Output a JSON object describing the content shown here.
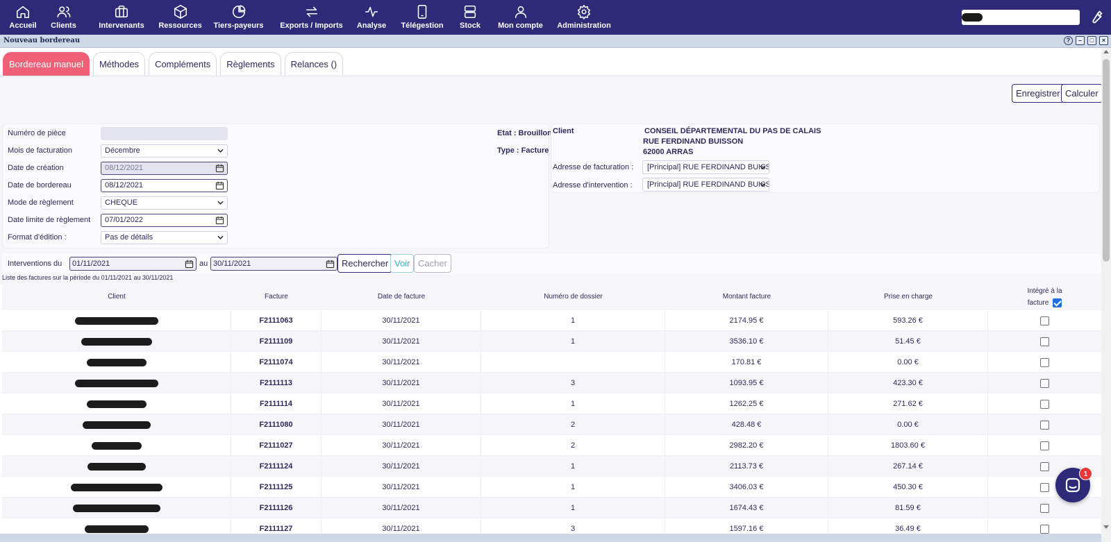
{
  "nav": {
    "items": [
      {
        "label": "Accueil",
        "icon": "home-icon"
      },
      {
        "label": "Clients",
        "icon": "users-icon"
      },
      {
        "label": "Intervenants",
        "icon": "briefcase-icon"
      },
      {
        "label": "Ressources",
        "icon": "box-icon"
      },
      {
        "label": "Tiers-payeurs",
        "icon": "pie-chart-icon"
      },
      {
        "label": "Exports / Imports",
        "icon": "arrows-icon"
      },
      {
        "label": "Analyse",
        "icon": "activity-icon"
      },
      {
        "label": "Télégestion",
        "icon": "phone-icon"
      },
      {
        "label": "Stock",
        "icon": "stack-icon"
      },
      {
        "label": "Mon compte",
        "icon": "person-icon"
      },
      {
        "label": "Administration",
        "icon": "gear-icon"
      }
    ]
  },
  "window": {
    "title": "Nouveau bordereau"
  },
  "tabs": [
    {
      "label": "Bordereau manuel",
      "active": true
    },
    {
      "label": "Méthodes",
      "active": false
    },
    {
      "label": "Compléments",
      "active": false
    },
    {
      "label": "Règlements",
      "active": false
    },
    {
      "label": "Relances ()",
      "active": false
    }
  ],
  "actions": {
    "save": "Enregistrer",
    "calculate": "Calculer"
  },
  "form": {
    "numero_piece": {
      "label": "Numéro de pièce",
      "value": ""
    },
    "mois_facturation": {
      "label": "Mois de facturation",
      "value": "Décembre"
    },
    "date_creation": {
      "label": "Date de création",
      "value": "08/12/2021"
    },
    "date_bordereau": {
      "label": "Date de bordereau",
      "value": "08/12/2021"
    },
    "mode_reglement": {
      "label": "Mode de règlement",
      "value": "CHEQUE"
    },
    "date_limite": {
      "label": "Date limite de règlement",
      "value": "07/01/2022"
    },
    "format_edition": {
      "label": "Format d'édition :",
      "value": "Pas de détails"
    },
    "etat": "Etat : Brouillon",
    "type": "Type : Facture"
  },
  "client": {
    "label": "Client",
    "name": "CONSEIL DÉPARTEMENTAL DU PAS DE CALAIS",
    "street": "RUE FERDINAND BUISSON",
    "city": "62000 ARRAS",
    "billing_label": "Adresse de facturation :",
    "billing_value": "[Principal] RUE FERDINAND BUISSON",
    "intervention_label": "Adresse d'intervention :",
    "intervention_value": "[Principal] RUE FERDINAND BUISSON"
  },
  "search": {
    "label_from": "Interventions du",
    "from": "01/11/2021",
    "label_to": "au",
    "to": "30/11/2021",
    "search_button": "Rechercher",
    "show_button": "Voir",
    "hide_button": "Cacher",
    "caption": "Liste des factures sur la période du 01/11/2021 au 30/11/2021"
  },
  "table": {
    "columns": {
      "client": "Client",
      "facture": "Facture",
      "date": "Date de facture",
      "dossier": "Numéro de dossier",
      "montant": "Montant facture",
      "prise": "Prise en charge",
      "integre_line1": "Intégré à la",
      "integre_line2": "facture"
    },
    "header_checked": true,
    "rows": [
      {
        "facture": "F2111063",
        "date": "30/11/2021",
        "dossier": "1",
        "montant": "2174.95 €",
        "prise": "593.26 €",
        "checked": false
      },
      {
        "facture": "F2111109",
        "date": "30/11/2021",
        "dossier": "1",
        "montant": "3536.10 €",
        "prise": "51.45 €",
        "checked": false
      },
      {
        "facture": "F2111074",
        "date": "30/11/2021",
        "dossier": "",
        "montant": "170.81 €",
        "prise": "0.00 €",
        "checked": false
      },
      {
        "facture": "F2111113",
        "date": "30/11/2021",
        "dossier": "3",
        "montant": "1093.95 €",
        "prise": "423.30 €",
        "checked": false
      },
      {
        "facture": "F2111114",
        "date": "30/11/2021",
        "dossier": "1",
        "montant": "1262.25 €",
        "prise": "271.62 €",
        "checked": false
      },
      {
        "facture": "F2111080",
        "date": "30/11/2021",
        "dossier": "2",
        "montant": "428.48 €",
        "prise": "0.00 €",
        "checked": false
      },
      {
        "facture": "F2111027",
        "date": "30/11/2021",
        "dossier": "2",
        "montant": "2982.20 €",
        "prise": "1803.60 €",
        "checked": false
      },
      {
        "facture": "F2111124",
        "date": "30/11/2021",
        "dossier": "1",
        "montant": "2113.73 €",
        "prise": "267.14 €",
        "checked": false
      },
      {
        "facture": "F2111125",
        "date": "30/11/2021",
        "dossier": "1",
        "montant": "3406.03 €",
        "prise": "450.30 €",
        "checked": false
      },
      {
        "facture": "F2111126",
        "date": "30/11/2021",
        "dossier": "1",
        "montant": "1674.43 €",
        "prise": "81.59 €",
        "checked": false
      },
      {
        "facture": "F2111127",
        "date": "30/11/2021",
        "dossier": "3",
        "montant": "1597.16 €",
        "prise": "36.49 €",
        "checked": false
      }
    ]
  },
  "chat": {
    "badge": "1"
  }
}
